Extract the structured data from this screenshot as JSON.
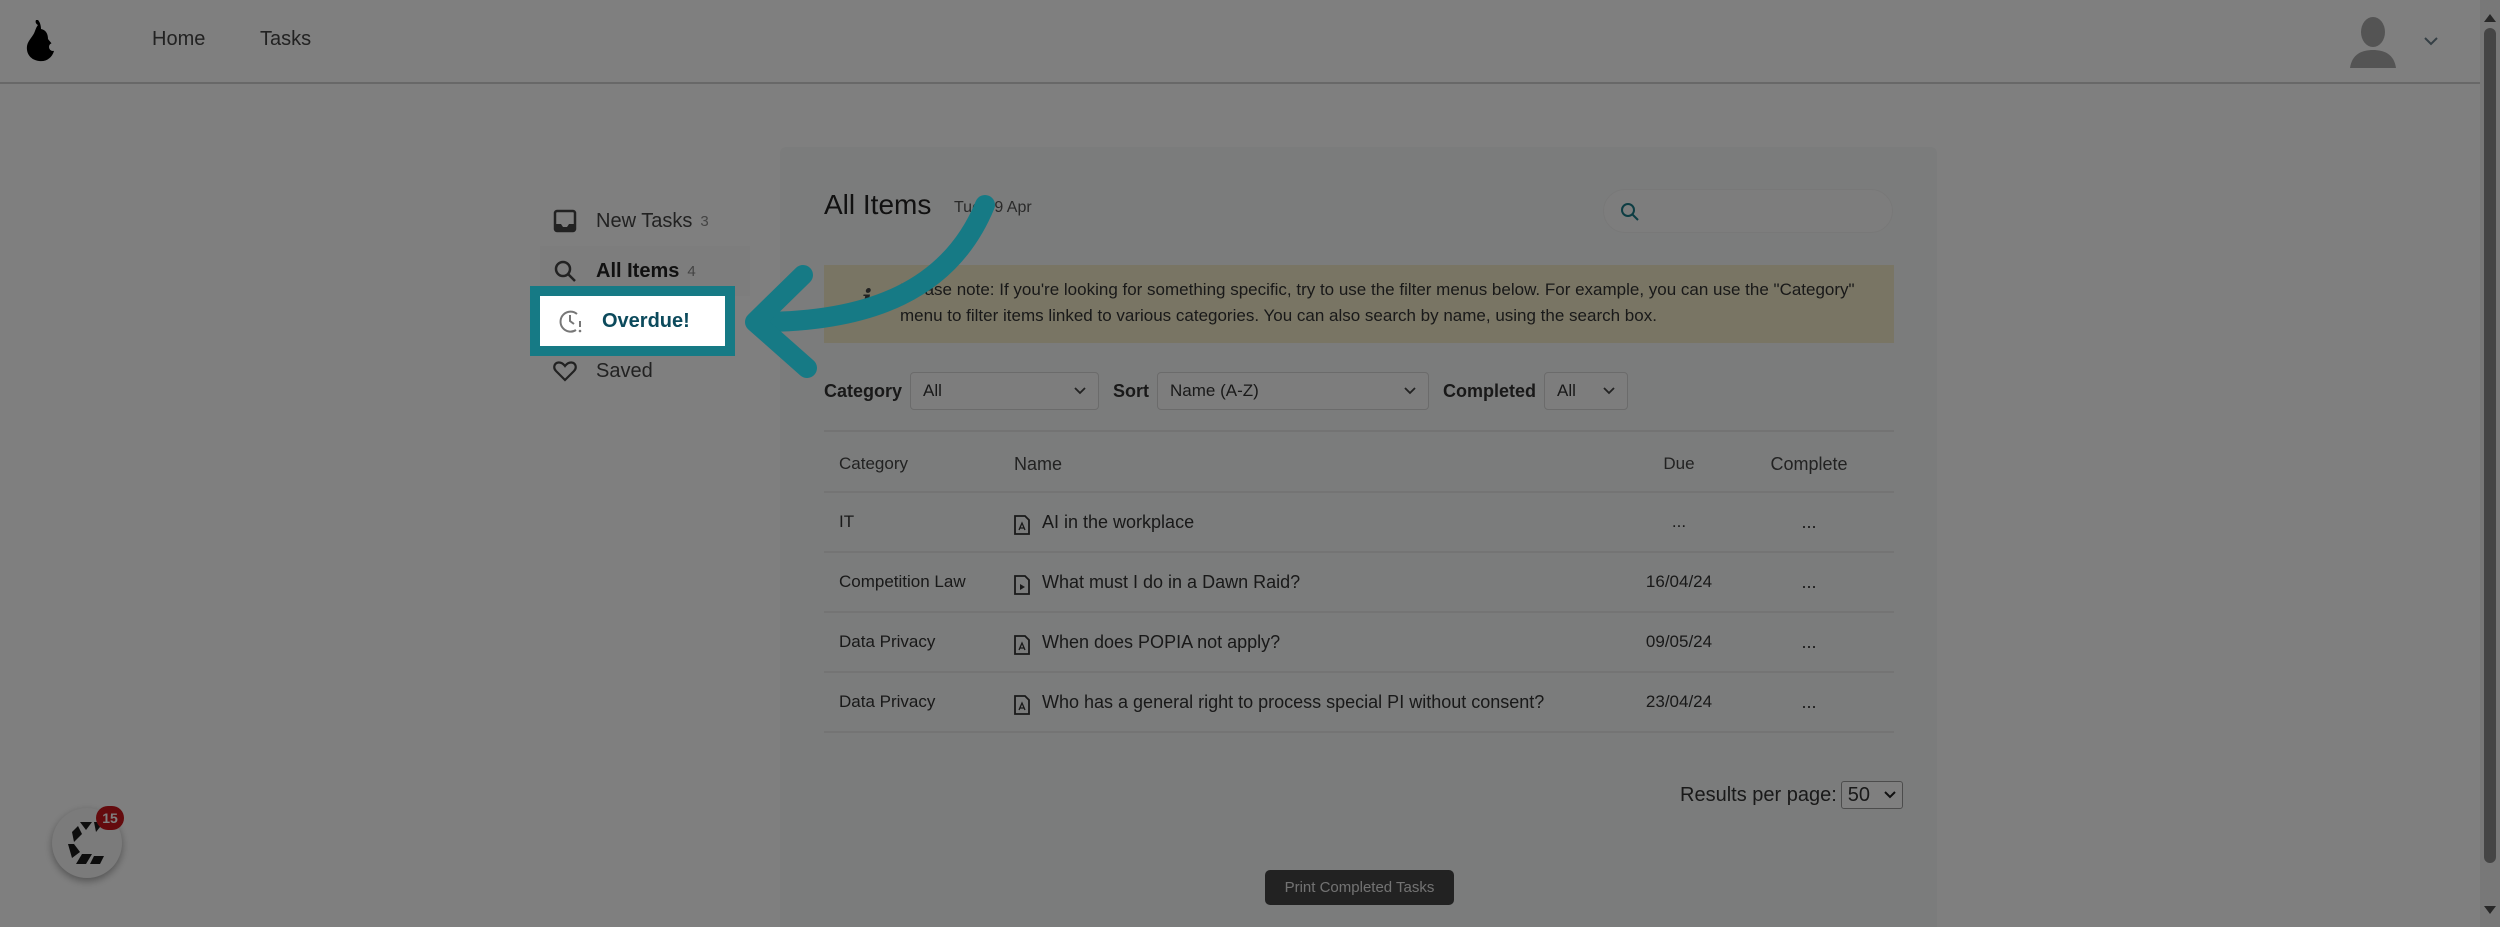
{
  "header": {
    "logo": "pear-logo",
    "nav": [
      {
        "label": "Home"
      },
      {
        "label": "Tasks"
      }
    ],
    "user_menu_icon": "user-avatar-icon"
  },
  "sidebar": {
    "items": [
      {
        "label": "New Tasks",
        "count": "3",
        "icon": "inbox-icon"
      },
      {
        "label": "All Items",
        "count": "4",
        "icon": "search-icon",
        "active": true
      },
      {
        "label": "Overdue!",
        "count": "",
        "icon": "clock-alert-icon"
      },
      {
        "label": "Saved",
        "count": "",
        "icon": "heart-icon"
      }
    ]
  },
  "main": {
    "title": "All Items",
    "date": "Tue 09 Apr",
    "search": {
      "placeholder": "",
      "value": ""
    },
    "notice": "Please note: If you're looking for something specific, try to use the filter menus below. For example, you can use the \"Category\" menu to filter items linked to various categories. You can also search by name, using the search box.",
    "filters": {
      "category": {
        "label": "Category",
        "value": "All"
      },
      "sort": {
        "label": "Sort",
        "value": "Name (A-Z)"
      },
      "completed": {
        "label": "Completed",
        "value": "All"
      }
    },
    "table": {
      "headers": {
        "category": "Category",
        "name": "Name",
        "due": "Due",
        "complete": "Complete"
      },
      "rows": [
        {
          "category": "IT",
          "name": "AI in the workplace",
          "type": "pdf",
          "due": "...",
          "complete": "..."
        },
        {
          "category": "Competition Law",
          "name": "What must I do in a Dawn Raid?",
          "type": "video",
          "due": "16/04/24",
          "complete": "..."
        },
        {
          "category": "Data Privacy",
          "name": "When does POPIA not apply?",
          "type": "pdf",
          "due": "09/05/24",
          "complete": "..."
        },
        {
          "category": "Data Privacy",
          "name": "Who has a general right to process special PI without consent?",
          "type": "pdf",
          "due": "23/04/24",
          "complete": "..."
        }
      ]
    },
    "results_per_page": {
      "label": "Results per page:",
      "value": "50"
    },
    "print_button": "Print Completed Tasks"
  },
  "chat_widget": {
    "badge_count": "15"
  },
  "tutorial_overlay": {
    "highlight_label": "Overdue!",
    "accent_color": "#167a85",
    "dim_opacity": 0.5
  }
}
